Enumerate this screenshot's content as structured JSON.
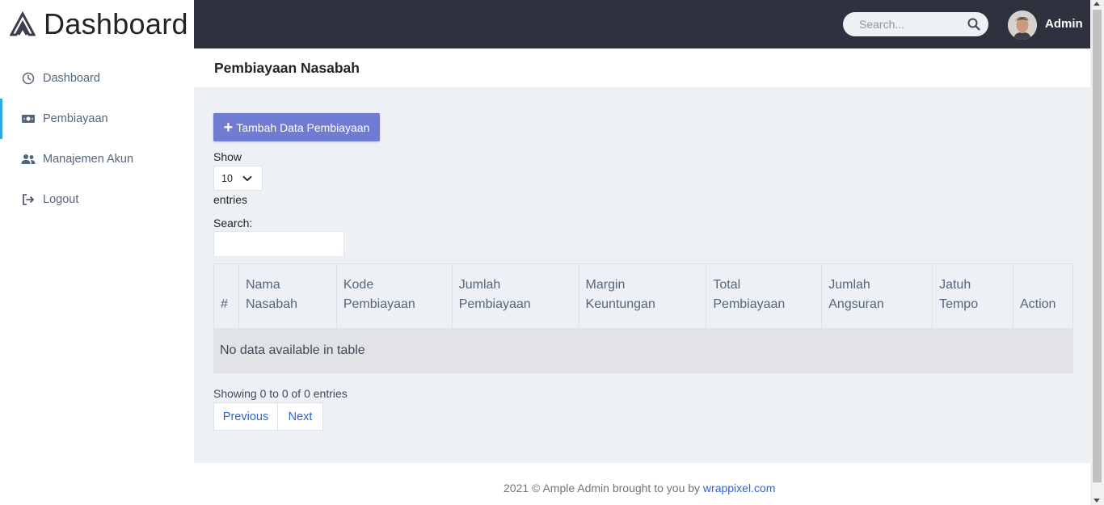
{
  "brand": {
    "title": "Dashboard"
  },
  "sidebar": {
    "items": [
      {
        "label": "Dashboard",
        "icon": "clock-icon",
        "active": false
      },
      {
        "label": "Pembiayaan",
        "icon": "money-bill-icon",
        "active": true
      },
      {
        "label": "Manajemen Akun",
        "icon": "users-icon",
        "active": false
      },
      {
        "label": "Logout",
        "icon": "sign-out-icon",
        "active": false
      }
    ]
  },
  "topbar": {
    "search_placeholder": "Search...",
    "user_name": "Admin"
  },
  "page": {
    "title": "Pembiayaan Nasabah"
  },
  "content": {
    "add_button_label": "Tambah Data Pembiayaan",
    "show_label": "Show",
    "entries_select_value": "10",
    "entries_label": "entries",
    "search_label": "Search:",
    "table": {
      "headers": [
        [
          "#"
        ],
        [
          "Nama",
          "Nasabah"
        ],
        [
          "Kode",
          "Pembiayaan"
        ],
        [
          "Jumlah",
          "Pembiayaan"
        ],
        [
          "Margin",
          "Keuntungan"
        ],
        [
          "Total",
          "Pembiayaan"
        ],
        [
          "Jumlah",
          "Angsuran"
        ],
        [
          "Jatuh",
          "Tempo"
        ],
        [
          "Action"
        ]
      ],
      "empty_message": "No data available in table"
    },
    "info_text": "Showing 0 to 0 of 0 entries",
    "pagination": {
      "previous": "Previous",
      "next": "Next"
    }
  },
  "footer": {
    "text": "2021 © Ample Admin brought to you by ",
    "link": "wrappixel.com"
  },
  "colors": {
    "topbar": "#2f323e",
    "accent": "#707cd2",
    "active_indicator": "#2cabe3",
    "content_bg": "#edf1f5",
    "link": "#2e63d8"
  }
}
